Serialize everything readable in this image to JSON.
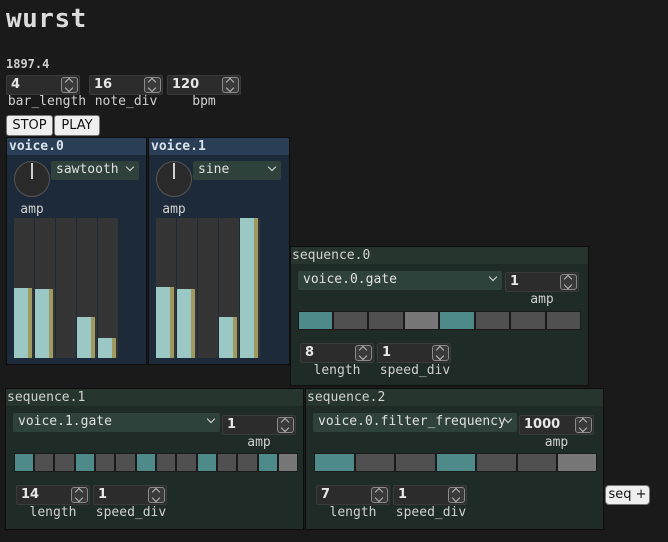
{
  "app": {
    "title": "wurst",
    "clock": "1897.4"
  },
  "transport": {
    "bar_length": {
      "value": "4",
      "label": "bar_length"
    },
    "note_div": {
      "value": "16",
      "label": "note_div"
    },
    "bpm": {
      "value": "120",
      "label": "bpm"
    },
    "stop_label": "STOP",
    "play_label": "PLAY"
  },
  "voices": [
    {
      "name": "voice.0",
      "waveform": "sawtooth",
      "amp_label": "amp",
      "levels": [
        0.5,
        0.49,
        0.0,
        0.29,
        0.14
      ]
    },
    {
      "name": "voice.1",
      "waveform": "sine",
      "amp_label": "amp",
      "levels": [
        0.51,
        0.49,
        0.0,
        0.29,
        1.0
      ]
    }
  ],
  "sequences": [
    {
      "name": "sequence.0",
      "target": "voice.0.gate",
      "amp": "1",
      "amp_label": "amp",
      "steps": [
        "on",
        "off",
        "off",
        "mid",
        "on",
        "off",
        "off",
        "off"
      ],
      "length": "8",
      "length_label": "length",
      "speed_div": "1",
      "speed_div_label": "speed_div"
    },
    {
      "name": "sequence.1",
      "target": "voice.1.gate",
      "amp": "1",
      "amp_label": "amp",
      "steps": [
        "on",
        "off",
        "off",
        "on",
        "off",
        "off",
        "on",
        "off",
        "off",
        "on",
        "off",
        "off",
        "on",
        "mid"
      ],
      "length": "14",
      "length_label": "length",
      "speed_div": "1",
      "speed_div_label": "speed_div"
    },
    {
      "name": "sequence.2",
      "target": "voice.0.filter_frequency",
      "amp": "1000",
      "amp_label": "amp",
      "steps": [
        "on",
        "off",
        "off",
        "on",
        "off",
        "off",
        "mid"
      ],
      "length": "7",
      "length_label": "length",
      "speed_div": "1",
      "speed_div_label": "speed_div"
    }
  ],
  "add_sequence_label": "seq +",
  "colors": {
    "step_on": "#4f8a8b",
    "step_off": "#505050",
    "step_mid": "#777777",
    "level_fill": "#9bc7c4"
  }
}
